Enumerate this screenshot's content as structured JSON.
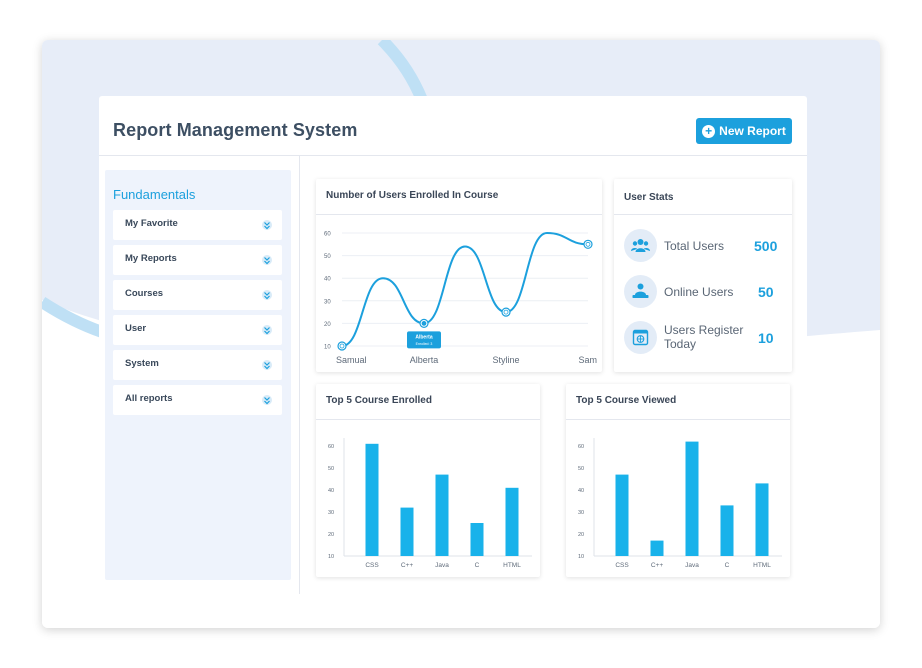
{
  "app": {
    "title": "Report Management System",
    "new_report_label": "New Report"
  },
  "colors": {
    "accent": "#1ca0dd",
    "sidebar_bg": "#eef3fc",
    "text": "#3d4f63"
  },
  "sidebar": {
    "heading": "Fundamentals",
    "items": [
      {
        "label": "My Favorite",
        "icon": "chevron-down-icon"
      },
      {
        "label": "My Reports",
        "icon": "chevron-down-icon"
      },
      {
        "label": "Courses",
        "icon": "chevron-down-icon"
      },
      {
        "label": "User",
        "icon": "chevron-down-icon"
      },
      {
        "label": "System",
        "icon": "chevron-down-icon"
      },
      {
        "label": "All reports",
        "icon": "chevron-down-icon"
      }
    ]
  },
  "user_stats": {
    "title": "User Stats",
    "rows": [
      {
        "label": "Total Users",
        "value": "500",
        "icon": "users-group-icon"
      },
      {
        "label": "Online Users",
        "value": "50",
        "icon": "user-at-laptop-icon"
      },
      {
        "label": "Users Register Today",
        "value": "10",
        "icon": "calendar-globe-icon"
      }
    ]
  },
  "chart_data": [
    {
      "type": "line",
      "title": "Number of Users Enrolled In Course",
      "categories": [
        "Samual",
        "Alberta",
        "Styline",
        "Sam"
      ],
      "series": [
        {
          "values": [
            10,
            20,
            25,
            55
          ]
        }
      ],
      "smooth_path_peaks": [
        40,
        54,
        60
      ],
      "yticks": [
        10,
        20,
        30,
        40,
        50,
        60
      ],
      "ylim": [
        10,
        60
      ],
      "tooltip": {
        "title": "Alberta",
        "subtitle": "Enrolled: 3"
      },
      "grid": true
    },
    {
      "type": "bar",
      "title": "Top 5 Course Enrolled",
      "categories": [
        "CSS",
        "C++",
        "Java",
        "C",
        "HTML"
      ],
      "values": [
        61,
        32,
        47,
        25,
        41
      ],
      "yticks": [
        10,
        20,
        30,
        40,
        50,
        60
      ],
      "ylim": [
        10,
        60
      ]
    },
    {
      "type": "bar",
      "title": "Top 5 Course Viewed",
      "categories": [
        "CSS",
        "C++",
        "Java",
        "C",
        "HTML"
      ],
      "values": [
        47,
        17,
        62,
        33,
        43
      ],
      "yticks": [
        10,
        20,
        30,
        40,
        50,
        60
      ],
      "ylim": [
        10,
        60
      ]
    }
  ]
}
